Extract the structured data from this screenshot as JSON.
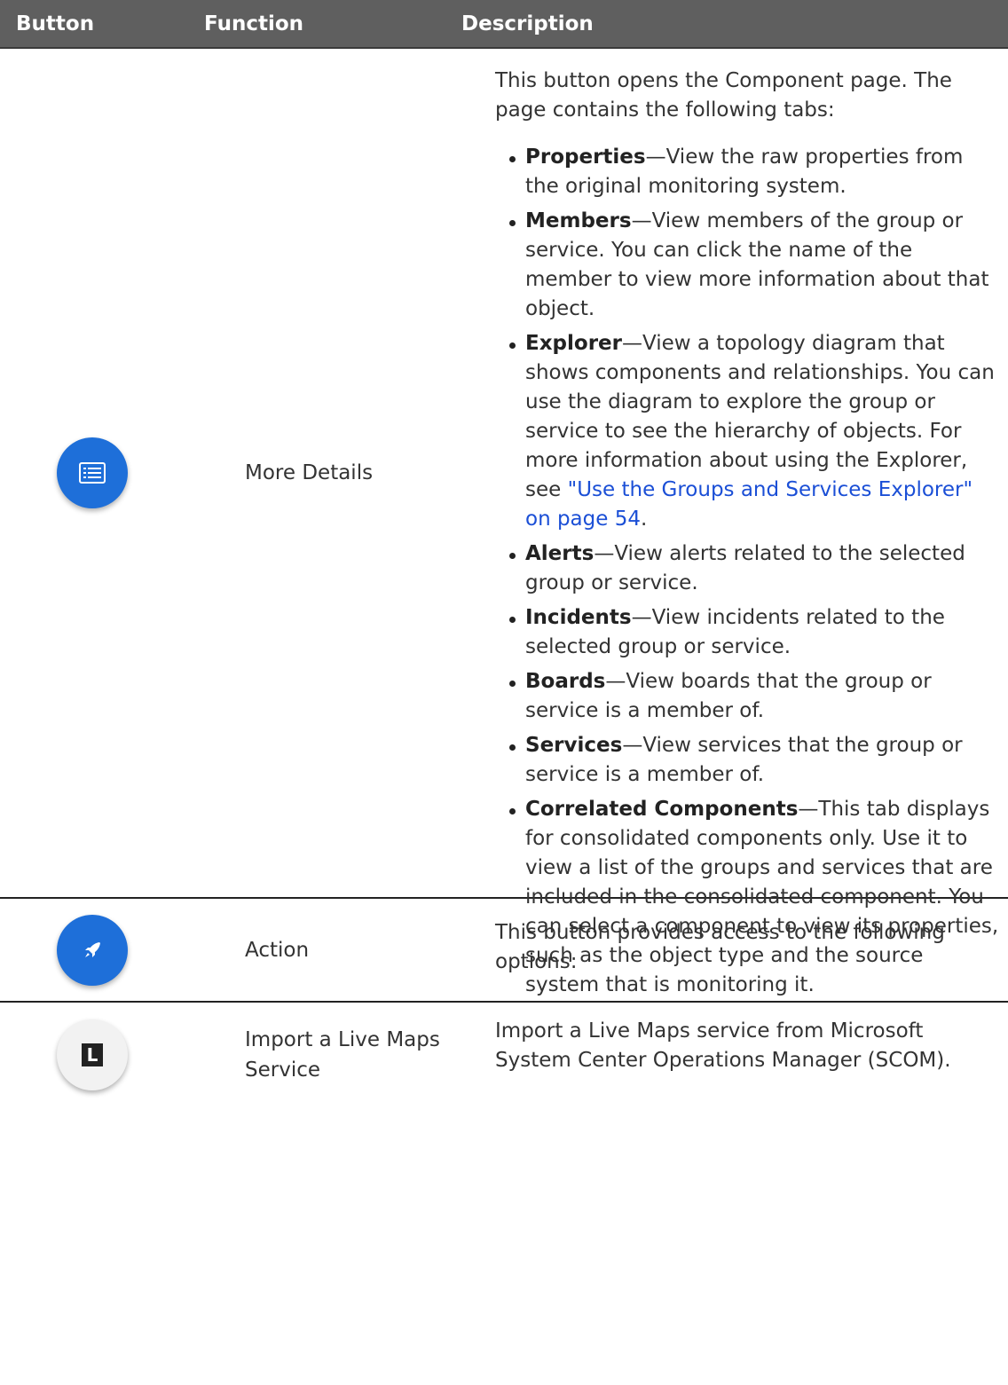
{
  "header": {
    "col_button": "Button",
    "col_function": "Function",
    "col_description": "Description"
  },
  "rows": [
    {
      "icon": "details-list-icon",
      "function": "More Details",
      "intro": "This button opens the Component page. The page contains the following tabs:",
      "tabs": [
        {
          "name": "Properties",
          "text": "—View the raw properties from the original monitoring system."
        },
        {
          "name": "Members",
          "text": "—View members of the group or service. You can click the name of the member to view more information about that object."
        },
        {
          "name": "Explorer",
          "text": "—View a topology diagram that shows components and relationships. You can use the diagram to explore the group or service to see the hierarchy of objects. For more information about using the Explorer, see ",
          "link": "\"Use the Groups and Services Explorer\" on page 54",
          "after": "."
        },
        {
          "name": "Alerts",
          "text": "—View alerts related to the selected group or service."
        },
        {
          "name": "Incidents",
          "text": "—View incidents related to the selected group or service."
        },
        {
          "name": "Boards",
          "text": "—View boards that the group or service is a member of."
        },
        {
          "name": "Services",
          "text": "—View services that the group or service is a member of."
        },
        {
          "name": "Correlated Components",
          "text": "—This tab displays for consolidated components only. Use it to view a list of the groups and services that are included in the consolidated component. You can select a component to view its properties, such as the object type and the source system that is monitoring it."
        }
      ]
    },
    {
      "icon": "rocket-icon",
      "function": "Action",
      "description": "This button provides access to the following options:"
    },
    {
      "icon": "live-maps-l-icon",
      "icon_letter": "L",
      "function": "Import a Live Maps Service",
      "description": "Import a Live Maps service from Microsoft System Center Operations Manager (SCOM)."
    }
  ]
}
